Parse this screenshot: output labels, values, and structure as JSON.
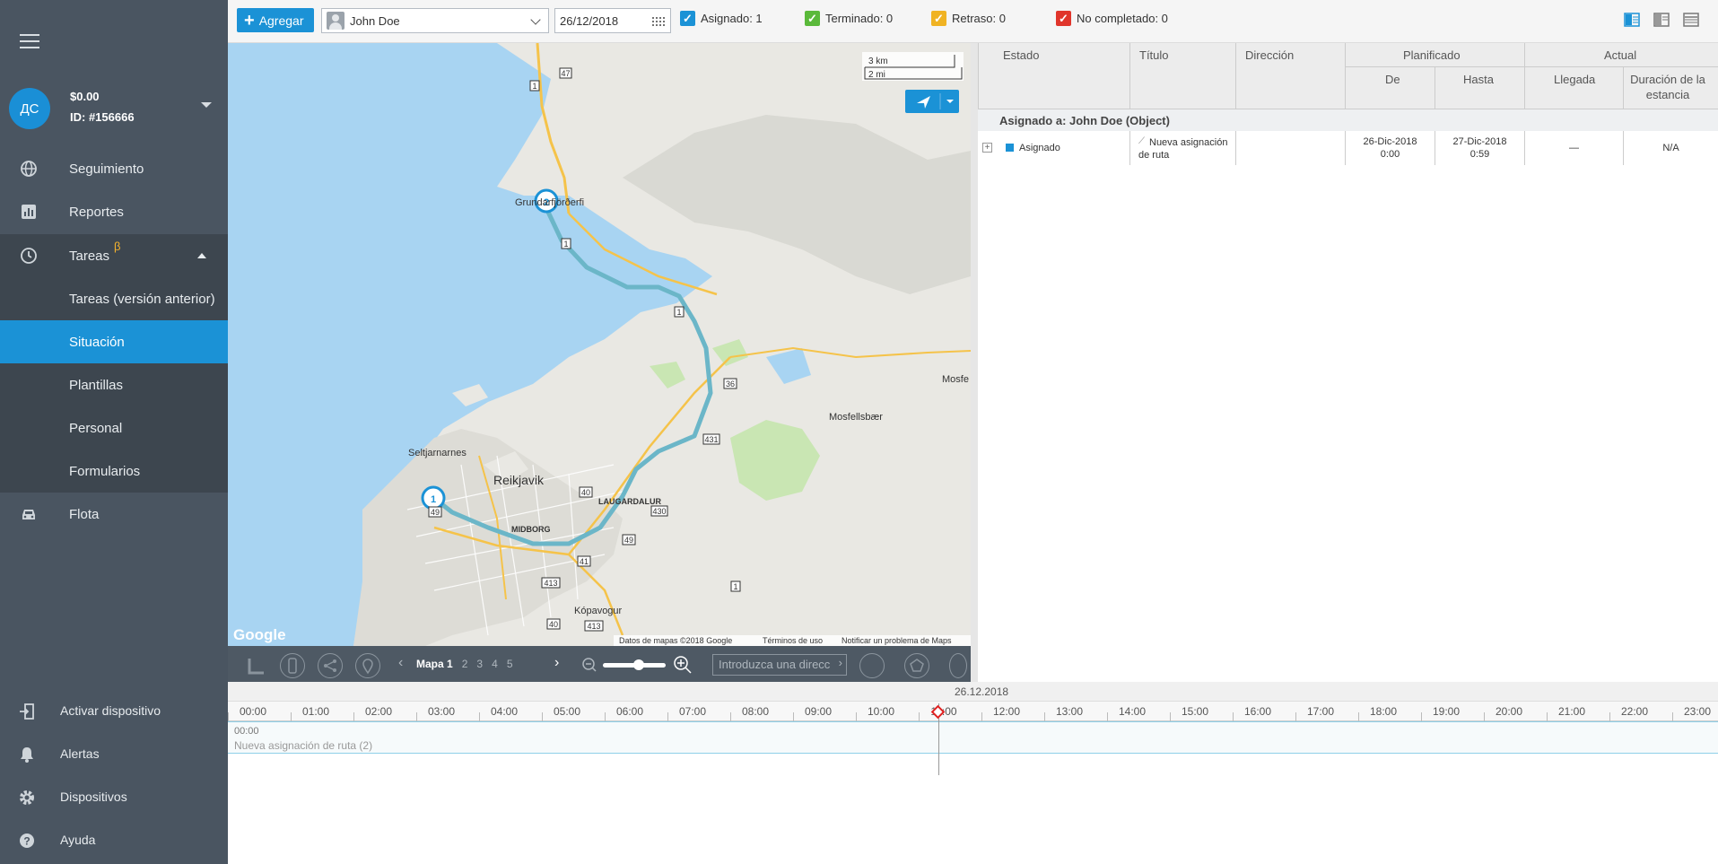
{
  "sidebar": {
    "account": {
      "initials": "ДС",
      "balance": "$0.00",
      "id": "ID: #156666"
    },
    "nav": {
      "tracking": "Seguimiento",
      "reports": "Reportes",
      "tasks": "Tareas",
      "tasks_badge": "β",
      "tasks_old": "Tareas (versión anterior)",
      "situation": "Situación",
      "templates": "Plantillas",
      "personal": "Personal",
      "forms": "Formularios",
      "fleet": "Flota"
    },
    "bottom": {
      "activate_device": "Activar dispositivo",
      "alerts": "Alertas",
      "devices": "Dispositivos",
      "help": "Ayuda"
    }
  },
  "toolbar": {
    "add_label": "Agregar",
    "user_value": "John  Doe",
    "date_value": "26/12/2018",
    "filters": [
      {
        "label": "Asignado: 1",
        "color": "#1b92d6"
      },
      {
        "label": "Terminado: 0",
        "color": "#5ab93a"
      },
      {
        "label": "Retraso: 0",
        "color": "#f0b323"
      },
      {
        "label": "No completado: 0",
        "color": "#e0352b"
      }
    ]
  },
  "map": {
    "scale_km": "3 km",
    "scale_mi": "2 mi",
    "labels": {
      "grundarfjordur": "Grundarfjörðerfi",
      "seltjarnarnes": "Seltjarnarnes",
      "reykjavik": "Reikjavik",
      "laugardalur": "LAUGARDALUR",
      "midborg": "MIDBORG",
      "mosfellsbaer": "Mosfellsbær",
      "mosfe": "Mosfe",
      "kopavogur": "Kópavogur"
    },
    "road_numbers": [
      "47",
      "1",
      "1",
      "1",
      "36",
      "431",
      "430",
      "40",
      "49",
      "41",
      "413",
      "413",
      "40",
      "49",
      "1"
    ],
    "pins": [
      "1",
      "2"
    ],
    "attribution": "Datos de mapas ©2018 Google",
    "terms": "Términos de uso",
    "report": "Notificar un problema de Maps",
    "google": "Google",
    "toolbar": {
      "tab_current": "Mapa 1",
      "tabs": [
        "2",
        "3",
        "4",
        "5"
      ],
      "address_placeholder": "Introduzca una dirección"
    }
  },
  "table": {
    "headers": {
      "status": "Estado",
      "title": "Título",
      "address": "Dirección",
      "planned": "Planificado",
      "actual": "Actual",
      "from": "De",
      "to": "Hasta",
      "arrival": "Llegada",
      "stay": "Duración de la estancia"
    },
    "group": "Asignado a: John Doe (Object)",
    "rows": [
      {
        "status": "Asignado",
        "title": "Nueva asignación de ruta",
        "address": "",
        "from_date": "26-Dic-2018",
        "from_time": "0:00",
        "to_date": "27-Dic-2018",
        "to_time": "0:59",
        "arrival": "—",
        "stay": "N/A"
      }
    ]
  },
  "timeline": {
    "date": "26.12.2018",
    "hours": [
      "00:00",
      "01:00",
      "02:00",
      "03:00",
      "04:00",
      "05:00",
      "06:00",
      "07:00",
      "08:00",
      "09:00",
      "10:00",
      "11:00",
      "12:00",
      "13:00",
      "14:00",
      "15:00",
      "16:00",
      "17:00",
      "18:00",
      "19:00",
      "20:00",
      "21:00",
      "22:00",
      "23:00"
    ],
    "row_time": "00:00",
    "row_name": "Nueva asignación de ruta (2)"
  }
}
